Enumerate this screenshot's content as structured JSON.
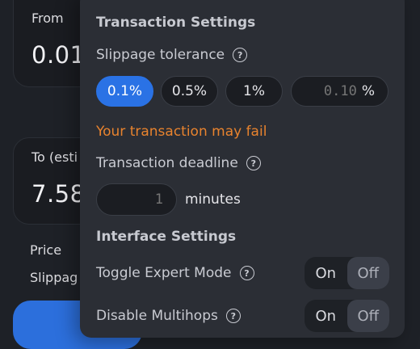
{
  "swap": {
    "from_label": "From",
    "from_value": "0.01",
    "to_label": "To (esti",
    "to_value": "7.58",
    "price_label": "Price",
    "slippage_label": "Slippag"
  },
  "settings": {
    "title": "Transaction Settings",
    "slippage_label": "Slippage tolerance",
    "slippage_options": [
      "0.1%",
      "0.5%",
      "1%"
    ],
    "slippage_selected": "0.1%",
    "slippage_placeholder": "0.10",
    "percent_symbol": "%",
    "warning": "Your transaction may fail",
    "deadline_label": "Transaction deadline",
    "deadline_placeholder": "1",
    "deadline_unit": "minutes",
    "interface_title": "Interface Settings",
    "expert_mode_label": "Toggle Expert Mode",
    "multihops_label": "Disable Multihops",
    "toggle_on": "On",
    "toggle_off": "Off",
    "help_glyph": "?"
  },
  "colors": {
    "accent": "#2a72e5",
    "warning": "#e8832e",
    "panel": "#2b2e35",
    "background": "#1e2127"
  },
  "icons": {
    "help": "question-circle-icon"
  }
}
